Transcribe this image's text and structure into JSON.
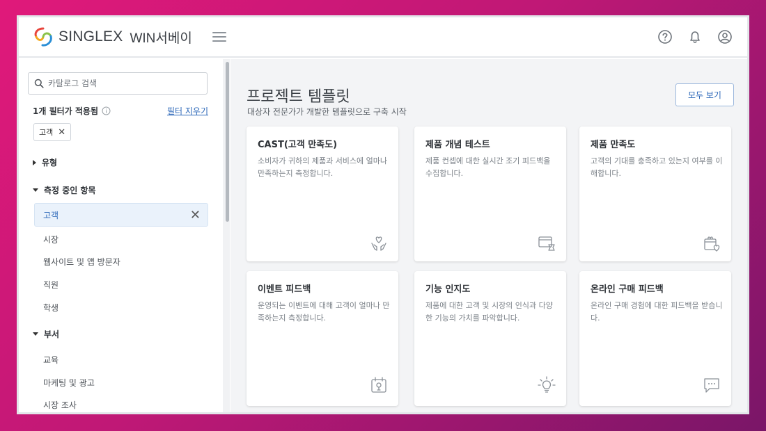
{
  "header": {
    "brand": "SINGLEX",
    "product": "WIN서베이",
    "icons": [
      "help-icon",
      "bell-icon",
      "account-icon"
    ]
  },
  "sidebar": {
    "search_placeholder": "카탈로그 검색",
    "filter_count": "1개 필터가 적용됨",
    "clear_filters": "필터 지우기",
    "chips": [
      {
        "label": "고객"
      }
    ],
    "sections": [
      {
        "label": "유형",
        "expanded": false
      },
      {
        "label": "측정 중인 항목",
        "expanded": true,
        "items": [
          "고객",
          "시장",
          "웹사이트 및 앱 방문자",
          "직원",
          "학생"
        ],
        "selected": "고객"
      },
      {
        "label": "부서",
        "expanded": true,
        "items": [
          "교육",
          "마케팅 및 광고",
          "시장 조사"
        ]
      }
    ]
  },
  "main": {
    "title": "프로젝트 템플릿",
    "subtitle": "대상자 전문가가 개발한 템플릿으로 구축 시작",
    "view_all": "모두 보기",
    "cards": [
      {
        "title": "CAST(고객 만족도)",
        "desc": "소비자가 귀하의 제품과 서비스에 얼마나 만족하는지 측정합니다.",
        "icon": "heart-hands-icon"
      },
      {
        "title": "제품 개념 테스트",
        "desc": "제품 컨셉에 대한 실시간 조기 피드백을 수집합니다.",
        "icon": "product-test-icon"
      },
      {
        "title": "제품 만족도",
        "desc": "고객의 기대를 충족하고 있는지 여부를 이해합니다.",
        "icon": "gift-heart-icon"
      },
      {
        "title": "이벤트 피드백",
        "desc": "운영되는 이벤트에 대해 고객이 얼마나 만족하는지 측정합니다.",
        "icon": "calendar-event-icon"
      },
      {
        "title": "기능 인지도",
        "desc": "제품에 대한 고객 및 시장의 인식과 다양한 기능의 가치를 파악합니다.",
        "icon": "lightbulb-icon"
      },
      {
        "title": "온라인 구매 피드백",
        "desc": "온라인 구매 경험에 대한 피드백을 받습니다.",
        "icon": "chat-icon"
      }
    ]
  }
}
